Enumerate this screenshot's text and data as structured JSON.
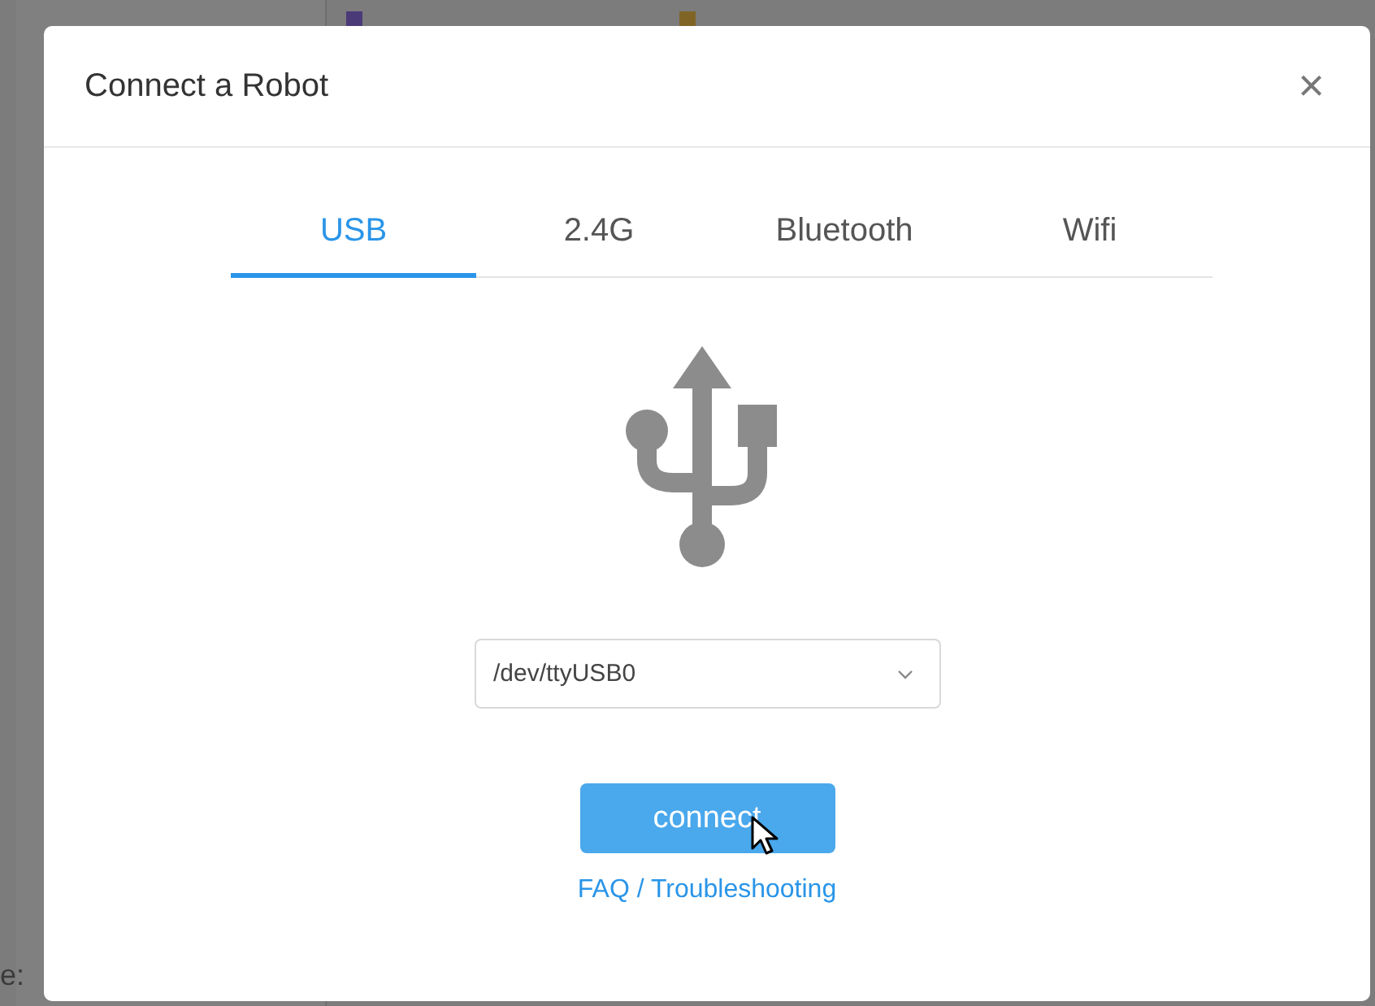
{
  "background": {
    "label": "e:"
  },
  "dialog": {
    "title": "Connect a Robot",
    "close": "×",
    "tabs": [
      {
        "label": "USB",
        "selected": true
      },
      {
        "label": "2.4G",
        "selected": false
      },
      {
        "label": "Bluetooth",
        "selected": false
      },
      {
        "label": "Wifi",
        "selected": false
      }
    ],
    "port": {
      "value": "/dev/ttyUSB0"
    },
    "connect_button": "connect",
    "help_link": "FAQ / Troubleshooting"
  }
}
